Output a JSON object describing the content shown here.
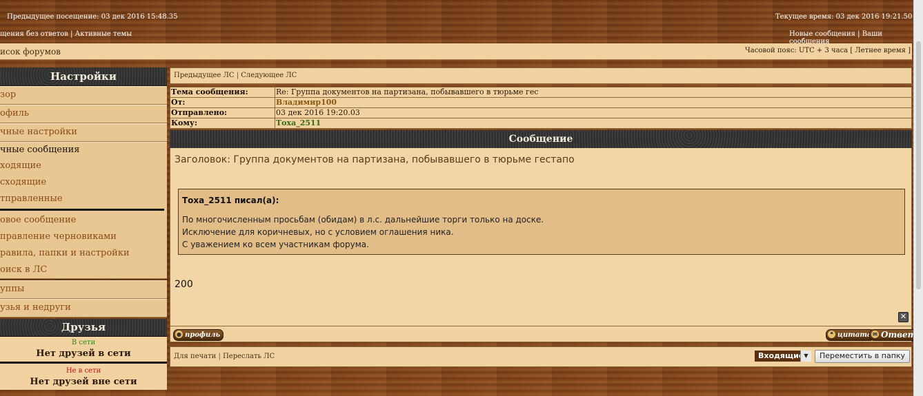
{
  "header": {
    "last_visit": "Предыдущее посещение: 03 дек 2016 15:48.35",
    "current_time": "Текущее время: 03 дек 2016 19:21.50",
    "nav_left": [
      "щения без ответов",
      "Активные темы"
    ],
    "nav_right": [
      "Новые сообщения",
      "Ваши сообщения"
    ],
    "separator": "|"
  },
  "breadcrumb": {
    "left": "исок форумов",
    "timezone": "Часовой пояс: UTC + 3 часа [ Летнее время ]"
  },
  "sidebar": {
    "settings_title": "Настройки",
    "items": [
      "зор",
      "офиль",
      "чные настройки"
    ],
    "pm_title": "чные сообщения",
    "pm_items": [
      "ходящие",
      "сходящие",
      "тправленные"
    ],
    "pm_actions": [
      "овое сообщение",
      "правление черновиками",
      "равила, папки и настройки",
      "оиск в ЛС"
    ],
    "items2": [
      "уппы",
      "узья и недруги"
    ],
    "friends_title": "Друзья",
    "online_label": "В сети",
    "online_none": "Нет друзей в сети",
    "offline_label": "Не в сети",
    "offline_none": "Нет друзей вне сети"
  },
  "pm": {
    "prev": "Предыдущее ЛС",
    "next": "Следующее ЛС",
    "separator": "|",
    "meta": {
      "subject_label": "Тема сообщения:",
      "subject_value": "Re: Группа документов на партизана, побывавшего в тюрьме гес",
      "from_label": "От:",
      "from_value": "Владимир100",
      "sent_label": "Отправлено:",
      "sent_value": "03 дек 2016 19:20.03",
      "to_label": "Кому:",
      "to_value": "Тоха_2511"
    },
    "message_title": "Сообщение",
    "subject_line": "Заголовок: Группа документов на партизана, побывавшего в тюрьме гестапо",
    "quote_author": "Тоха_2511 писал(а):",
    "quote_lines": [
      "По многочисленным просьбам (обидам) в л.с. дальнейшие торги только на доске.",
      "Исключение для коричневых, но с условием оглашения ника.",
      "С уважением ко всем участникам форума."
    ],
    "body": "200",
    "close_symbol": "✕",
    "profile_btn": "профиль",
    "quote_btn": "цитата",
    "reply_btn": "Ответ"
  },
  "footer": {
    "print": "Для печати",
    "forward": "Переслать ЛС",
    "separator": "|",
    "folder_selected": "Входящие",
    "move_btn": "Переместить в папку"
  }
}
